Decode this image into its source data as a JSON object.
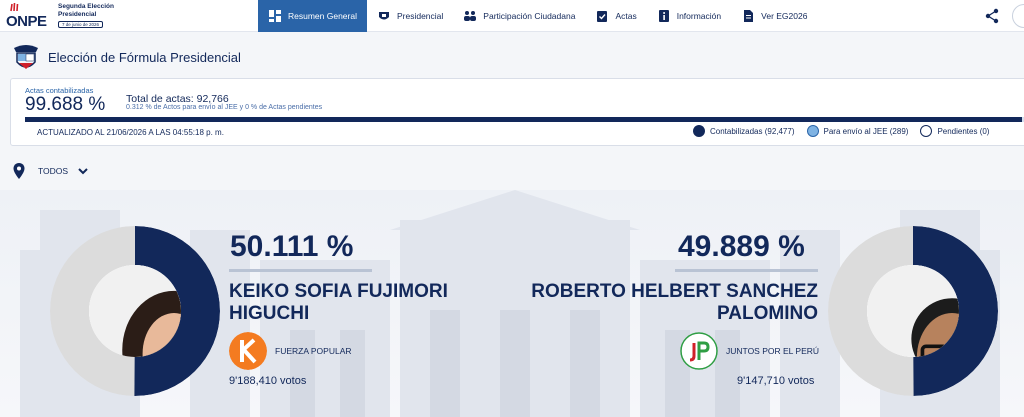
{
  "brand": {
    "name": "ONPE",
    "subtitle": "Segunda Elección Presidencial",
    "date": "7 de junio de 2026"
  },
  "nav": {
    "items": [
      {
        "label": "Resumen General",
        "icon": "dashboard-icon",
        "active": true
      },
      {
        "label": "Presidencial",
        "icon": "emblem-icon",
        "active": false
      },
      {
        "label": "Participación Ciudadana",
        "icon": "people-icon",
        "active": false
      },
      {
        "label": "Actas",
        "icon": "clipboard-check-icon",
        "active": false
      },
      {
        "label": "Información",
        "icon": "info-document-icon",
        "active": false
      },
      {
        "label": "Ver EG2026",
        "icon": "document-icon",
        "active": false
      }
    ]
  },
  "header": {
    "title": "Elección de Fórmula Presidencial"
  },
  "stats": {
    "counted_label": "Actas contabilizadas",
    "counted_pct": "99.688 %",
    "total_label": "Total de actas: 92,766",
    "note": "0.312 % de Actos para envío al JEE y 0 % de Actas pendientes",
    "progress": 0.99688,
    "updated": "ACTUALIZADO AL 21/06/2026 A LAS 04:55:18 p. m.",
    "legend": [
      {
        "label": "Contabilizadas (92,477)",
        "color": "#12285a"
      },
      {
        "label": "Para envío al JEE (289)",
        "color": "#7fb3e3"
      },
      {
        "label": "Pendientes (0)",
        "color": "#ffffff"
      }
    ]
  },
  "filter": {
    "label": "TODOS"
  },
  "candidates": [
    {
      "pct": "50.111 %",
      "share": 0.50111,
      "name_line1": "KEIKO SOFIA FUJIMORI",
      "name_line2": "HIGUCHI",
      "party": "FUERZA POPULAR",
      "party_logo_letter": "K",
      "party_color": "#f47b20",
      "votes": "9'188,410 votos"
    },
    {
      "pct": "49.889 %",
      "share": 0.49889,
      "name_line1": "ROBERTO HELBERT SANCHEZ",
      "name_line2": "PALOMINO",
      "party": "JUNTOS POR EL PERÚ",
      "party_logo_letter": "JP",
      "party_color": "#2f9e44",
      "votes": "9'147,710 votos"
    }
  ],
  "colors": {
    "navy": "#12285a",
    "accent": "#2a64a8",
    "ring_rest": "#dcdcdc"
  }
}
